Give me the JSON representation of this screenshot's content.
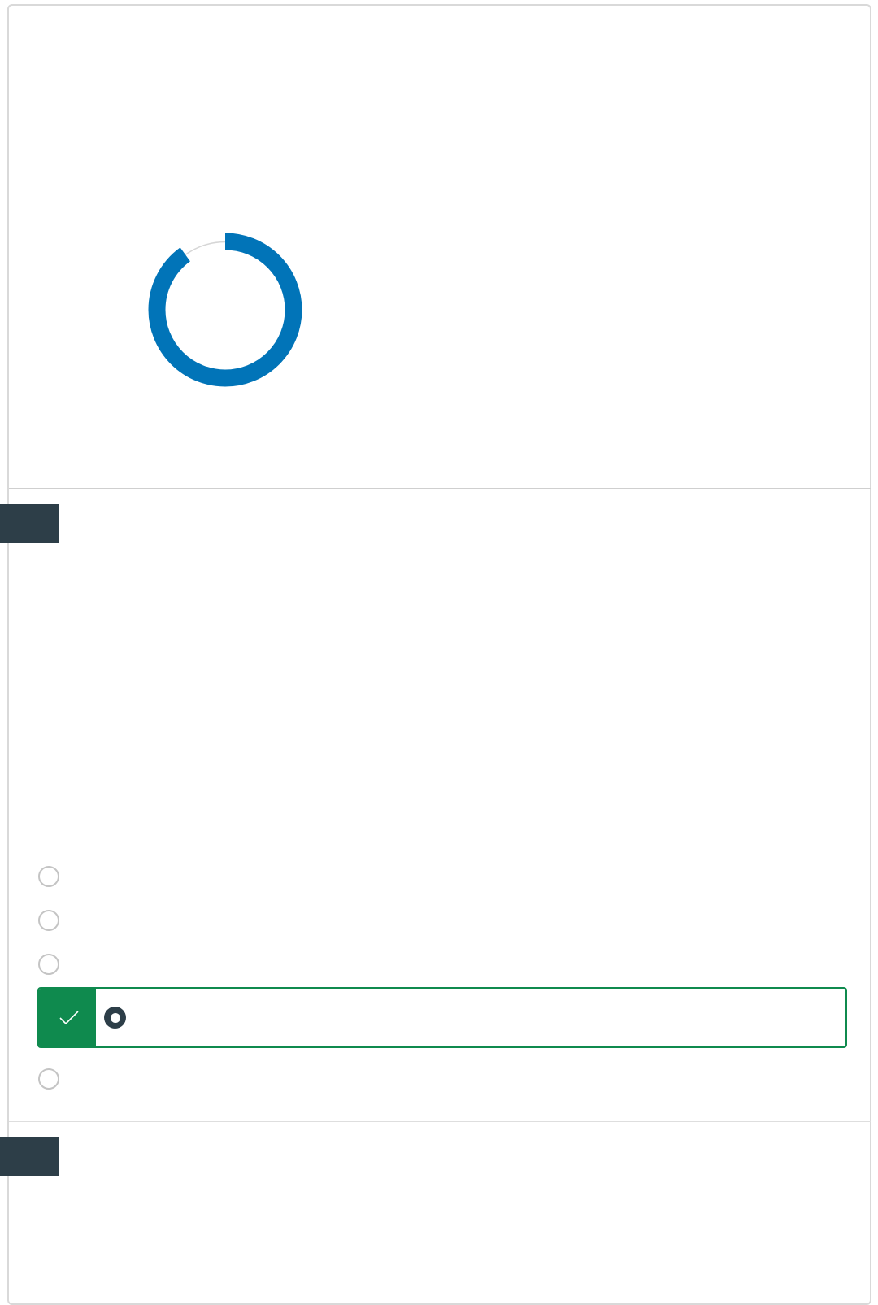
{
  "score": {
    "progress_percent": 90,
    "fill_color": "#0174b8",
    "track_color": "#d6d6d6"
  },
  "questions": [
    {
      "number": "",
      "options": [
        {
          "label": "",
          "selected": false,
          "correct": false
        },
        {
          "label": "",
          "selected": false,
          "correct": false
        },
        {
          "label": "",
          "selected": false,
          "correct": false
        },
        {
          "label": "",
          "selected": true,
          "correct": true
        },
        {
          "label": "",
          "selected": false,
          "correct": false
        }
      ]
    },
    {
      "number": "",
      "options": []
    }
  ],
  "colors": {
    "correct_green": "#0f8a4e",
    "badge_dark": "#2d3e48"
  },
  "icons": {
    "correct_marker": "checkmark-icon"
  }
}
